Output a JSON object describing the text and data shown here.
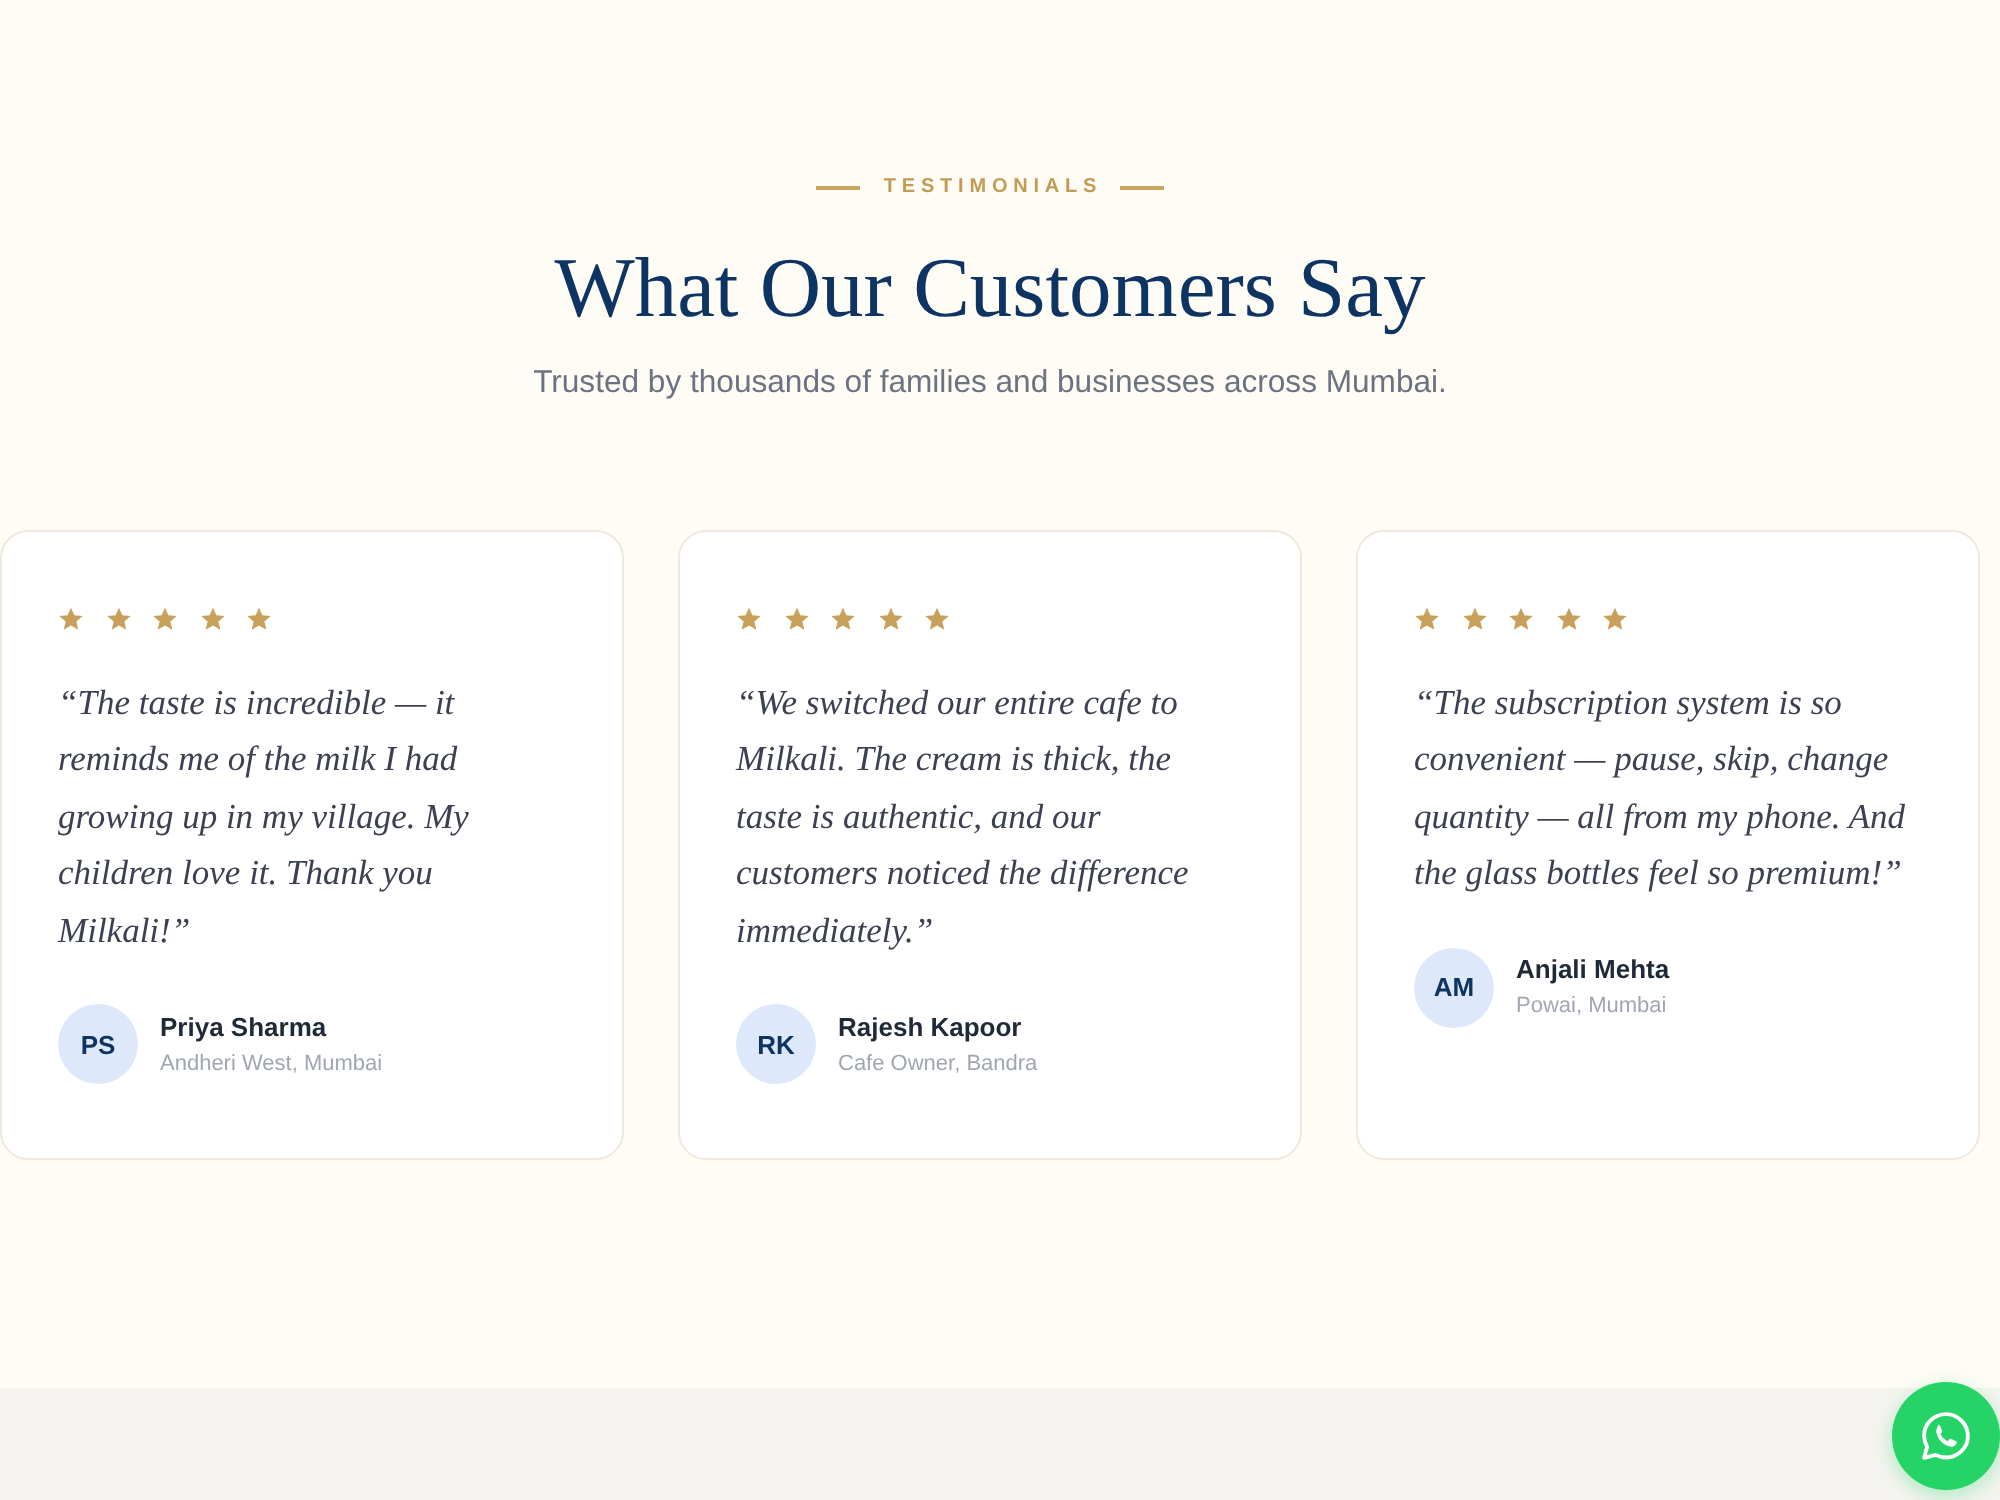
{
  "section": {
    "eyebrow": "TESTIMONIALS",
    "title": "What Our Customers Say",
    "subtitle": "Trusted by thousands of families and businesses across Mumbai."
  },
  "testimonials": [
    {
      "stars": 5,
      "quote": "“The taste is incredible — it reminds me of the milk I had growing up in my village. My children love it. Thank you Milkali!”",
      "initials": "PS",
      "name": "Priya Sharma",
      "location": "Andheri West, Mumbai"
    },
    {
      "stars": 5,
      "quote": "“We switched our entire cafe to Milkali. The cream is thick, the taste is authentic, and our customers noticed the difference immediately.”",
      "initials": "RK",
      "name": "Rajesh Kapoor",
      "location": "Cafe Owner, Bandra"
    },
    {
      "stars": 5,
      "quote": "“The subscription system is so convenient — pause, skip, change quantity — all from my phone. And the glass bottles feel so premium!”",
      "initials": "AM",
      "name": "Anjali Mehta",
      "location": "Powai, Mumbai"
    }
  ]
}
